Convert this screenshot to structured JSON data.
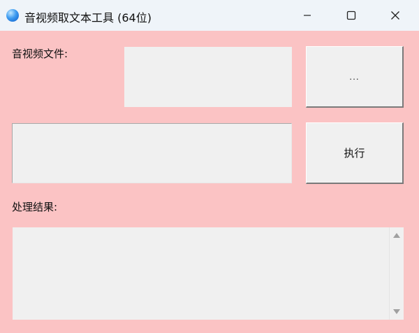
{
  "window": {
    "title": "音视频取文本工具 (64位)",
    "controls": {
      "minimize_icon": "minimize-icon",
      "maximize_icon": "maximize-icon",
      "close_icon": "close-icon"
    }
  },
  "form": {
    "file_label": "音视频文件:",
    "file_value": "",
    "browse_label": "...",
    "param_value": "",
    "run_label": "执行",
    "result_label": "处理结果:",
    "result_value": ""
  },
  "colors": {
    "background": "#fbc3c4",
    "titlebar": "#eff4f9",
    "control": "#f0f0f0"
  }
}
